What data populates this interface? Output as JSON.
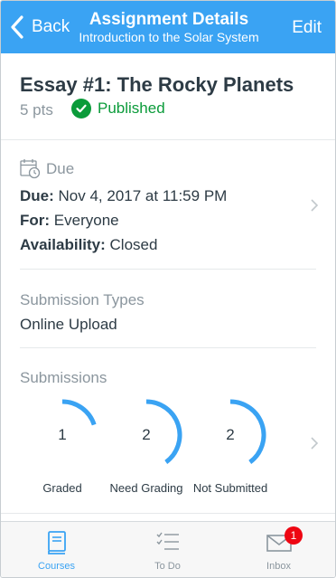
{
  "header": {
    "back_label": "Back",
    "title": "Assignment Details",
    "subtitle": "Introduction to the Solar System",
    "edit_label": "Edit"
  },
  "assignment": {
    "title": "Essay #1: The Rocky Planets",
    "points": "5 pts",
    "status": "Published",
    "status_icon": "check-circle-icon"
  },
  "due": {
    "heading": "Due",
    "icon": "calendar-clock-icon",
    "due_key": "Due:",
    "due_value": "Nov 4, 2017 at 11:59 PM",
    "for_key": "For:",
    "for_value": "Everyone",
    "availability_key": "Availability:",
    "availability_value": "Closed"
  },
  "submission_types": {
    "heading": "Submission Types",
    "value": "Online Upload"
  },
  "submissions": {
    "heading": "Submissions",
    "items": [
      {
        "count": "1",
        "label": "Graded",
        "fraction": 0.2
      },
      {
        "count": "2",
        "label": "Need Grading",
        "fraction": 0.4
      },
      {
        "count": "2",
        "label": "Not Submitted",
        "fraction": 0.4
      }
    ]
  },
  "tabbar": {
    "tabs": [
      {
        "label": "Courses",
        "icon": "book-icon",
        "active": true
      },
      {
        "label": "To Do",
        "icon": "checklist-icon",
        "active": false
      },
      {
        "label": "Inbox",
        "icon": "envelope-icon",
        "active": false,
        "badge": "1"
      }
    ]
  },
  "colors": {
    "accent": "#3aa3f3",
    "published": "#0b9b3a",
    "badge": "#ee0612",
    "muted": "#8b969e"
  }
}
